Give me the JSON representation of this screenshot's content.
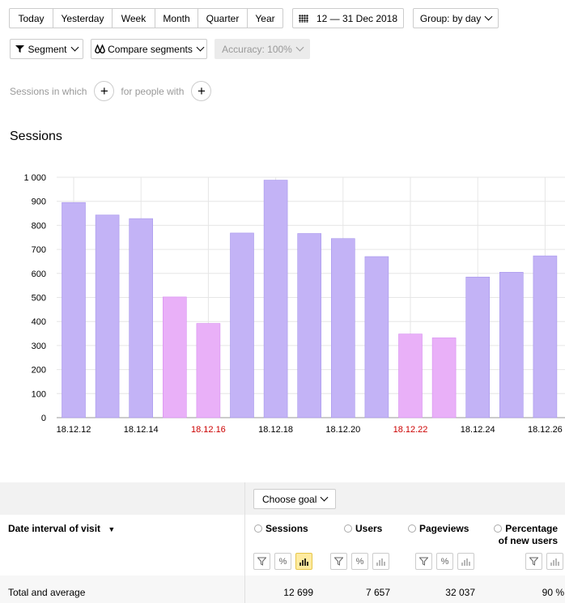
{
  "toolbar": {
    "periods": [
      "Today",
      "Yesterday",
      "Week",
      "Month",
      "Quarter",
      "Year"
    ],
    "date_range": "12 — 31 Dec 2018",
    "group": "Group: by day",
    "segment": "Segment",
    "compare": "Compare segments",
    "accuracy": "Accuracy: 100%"
  },
  "segments": {
    "sessions_in_which": "Sessions in which",
    "for_people_with": "for people with"
  },
  "report_title": "Sessions",
  "chart_data": {
    "type": "bar",
    "categories": [
      "18.12.12",
      "18.12.13",
      "18.12.14",
      "18.12.15",
      "18.12.16",
      "18.12.17",
      "18.12.18",
      "18.12.19",
      "18.12.20",
      "18.12.21",
      "18.12.22",
      "18.12.23",
      "18.12.24",
      "18.12.25",
      "18.12.26"
    ],
    "values": [
      895,
      843,
      828,
      502,
      392,
      768,
      988,
      766,
      745,
      670,
      348,
      332,
      585,
      605,
      673
    ],
    "weekend": [
      false,
      false,
      false,
      true,
      true,
      false,
      false,
      false,
      false,
      false,
      true,
      true,
      false,
      false,
      false
    ],
    "tick_labels": [
      "18.12.12",
      "18.12.14",
      "18.12.16",
      "18.12.18",
      "18.12.20",
      "18.12.22",
      "18.12.24",
      "18.12.26"
    ],
    "tick_label_red": [
      false,
      false,
      true,
      false,
      false,
      true,
      false,
      false
    ],
    "y_ticks": [
      "0",
      "100",
      "200",
      "300",
      "400",
      "500",
      "600",
      "700",
      "800",
      "900",
      "1 000"
    ],
    "ylim": [
      0,
      1000
    ],
    "colors": {
      "weekday": "#c3b3f6",
      "weekend": "#e9b0f8",
      "red_label": "#cc0000"
    }
  },
  "table": {
    "choose_goal": "Choose goal",
    "dimension_header": "Date interval of visit",
    "sort_arrow": "▼",
    "columns": [
      {
        "title": "Sessions",
        "title2": ""
      },
      {
        "title": "Users",
        "title2": ""
      },
      {
        "title": "Pageviews",
        "title2": ""
      },
      {
        "title": "Percentage",
        "title2": "of new users"
      }
    ],
    "total_label": "Total and average",
    "totals": [
      "12 699",
      "7 657",
      "32 037",
      "90 %"
    ]
  }
}
